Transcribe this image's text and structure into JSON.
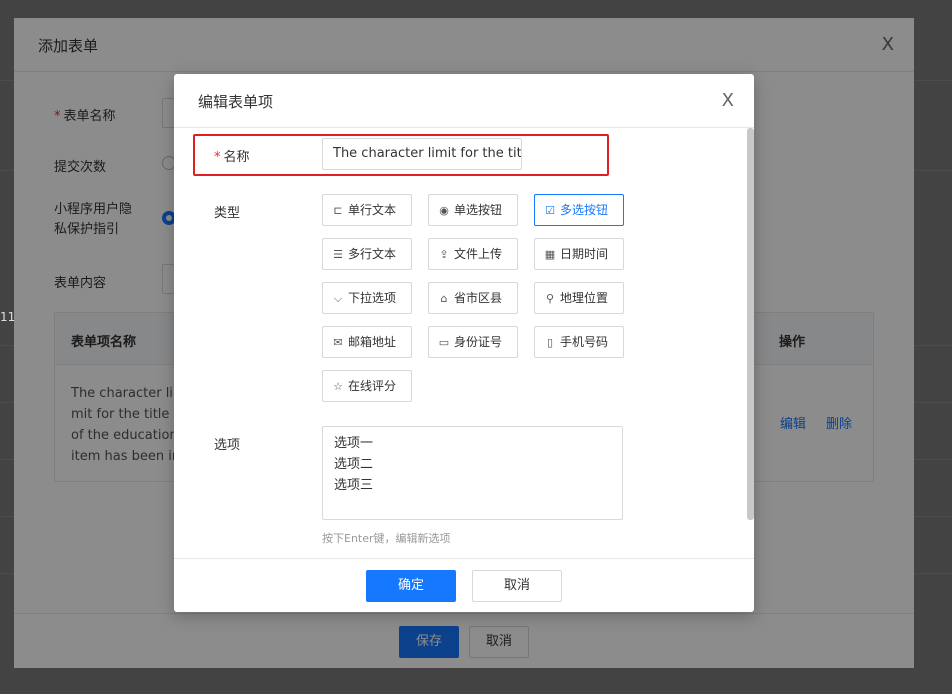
{
  "outer_dialog": {
    "title": "添加表单",
    "close_symbol": "X",
    "fields": {
      "form_name": "表单名称",
      "submit_times": "提交次数",
      "privacy_line1": "小程序用户隐",
      "privacy_line2": "私保护指引",
      "form_content": "表单内容"
    },
    "table": {
      "col_name": "表单项名称",
      "col_action": "操作",
      "row_text": "The character limit for the title of the education item has been increased to 200 characters.",
      "edit_link": "编辑",
      "delete_link": "删除"
    },
    "footer": {
      "save": "保存",
      "cancel": "取消"
    },
    "stray_number": "11"
  },
  "modal": {
    "title": "编辑表单项",
    "close_symbol": "X",
    "name_label": "名称",
    "name_value": "The character limit for the tit",
    "type_label": "类型",
    "types": [
      {
        "label": "单行文本",
        "icon": "single-line-text-icon",
        "glyph": "⊏",
        "active": false
      },
      {
        "label": "单选按钮",
        "icon": "radio-button-icon",
        "glyph": "◉",
        "active": false
      },
      {
        "label": "多选按钮",
        "icon": "checkbox-icon",
        "glyph": "☑",
        "active": true
      },
      {
        "label": "多行文本",
        "icon": "multi-line-text-icon",
        "glyph": "☰",
        "active": false
      },
      {
        "label": "文件上传",
        "icon": "upload-icon",
        "glyph": "⇪",
        "active": false
      },
      {
        "label": "日期时间",
        "icon": "calendar-icon",
        "glyph": "▦",
        "active": false
      },
      {
        "label": "下拉选项",
        "icon": "dropdown-icon",
        "glyph": "⌵",
        "active": false
      },
      {
        "label": "省市区县",
        "icon": "building-icon",
        "glyph": "⌂",
        "active": false
      },
      {
        "label": "地理位置",
        "icon": "location-icon",
        "glyph": "⚲",
        "active": false
      },
      {
        "label": "邮箱地址",
        "icon": "email-icon",
        "glyph": "✉",
        "active": false
      },
      {
        "label": "身份证号",
        "icon": "id-card-icon",
        "glyph": "▭",
        "active": false
      },
      {
        "label": "手机号码",
        "icon": "phone-icon",
        "glyph": "▯",
        "active": false
      },
      {
        "label": "在线评分",
        "icon": "star-icon",
        "glyph": "☆",
        "active": false
      }
    ],
    "options_label": "选项",
    "options": [
      "选项一",
      "选项二",
      "选项三"
    ],
    "hint": "按下Enter键，编辑新选项",
    "confirm": "确定",
    "cancel": "取消"
  },
  "colors": {
    "primary": "#1677ff",
    "highlight": "#e02020",
    "required": "#f5222d"
  }
}
